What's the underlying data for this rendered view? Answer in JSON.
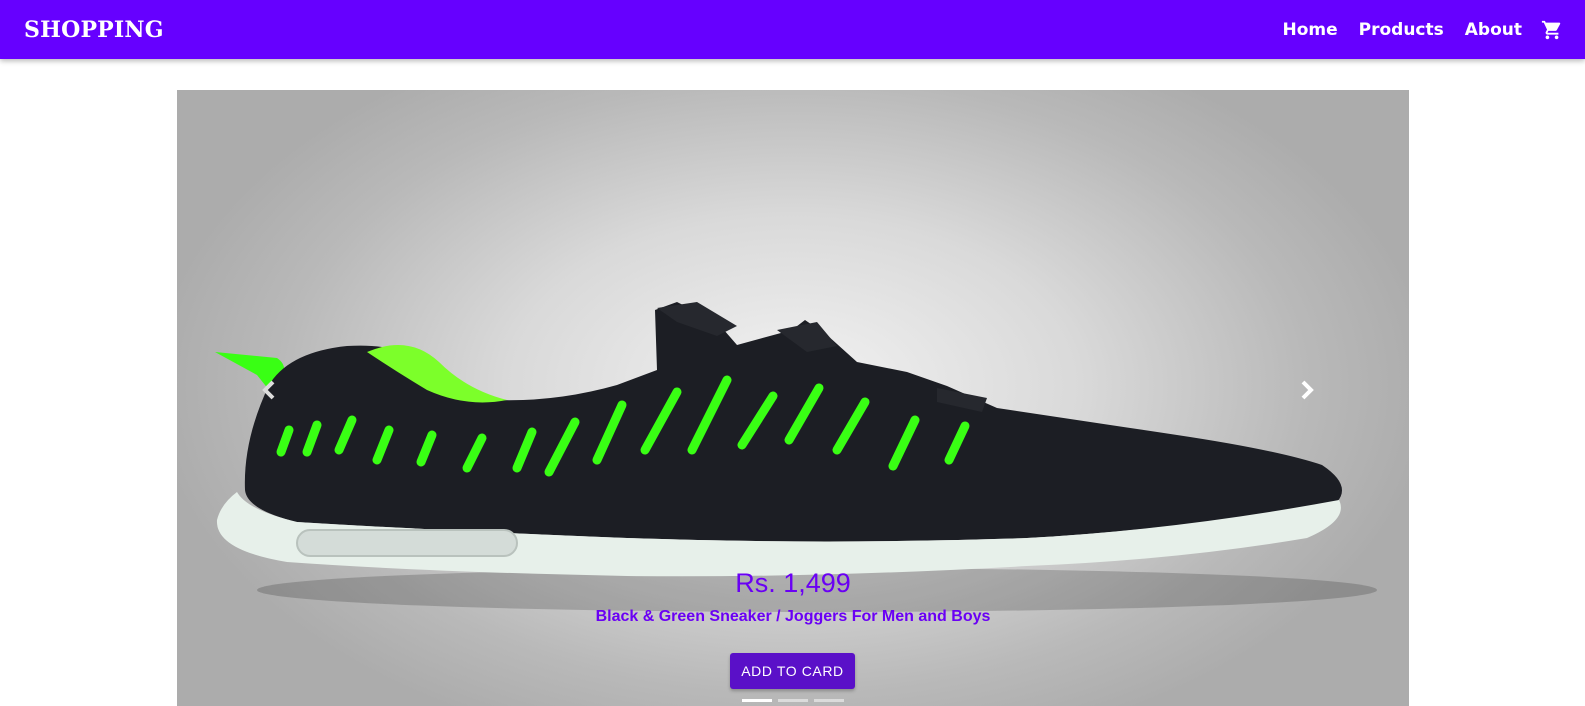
{
  "navbar": {
    "brand": "SHOPPING",
    "links": [
      "Home",
      "Products",
      "About"
    ],
    "cart_icon": "shopping-cart-icon"
  },
  "carousel": {
    "product_image": "black-and-green-sneaker",
    "prev_icon": "chevron-left-icon",
    "next_icon": "chevron-right-icon",
    "price": "Rs. 1,499",
    "product_name": "Black & Green Sneaker / Joggers For Men and Boys",
    "button_label": "ADD TO CARD",
    "slide_count": 3,
    "active_slide": 1
  },
  "colors": {
    "brand": "#6600ff",
    "accent_text": "#6a00f4",
    "button": "#5a10c8",
    "shoe_stripe": "#39ff14"
  }
}
